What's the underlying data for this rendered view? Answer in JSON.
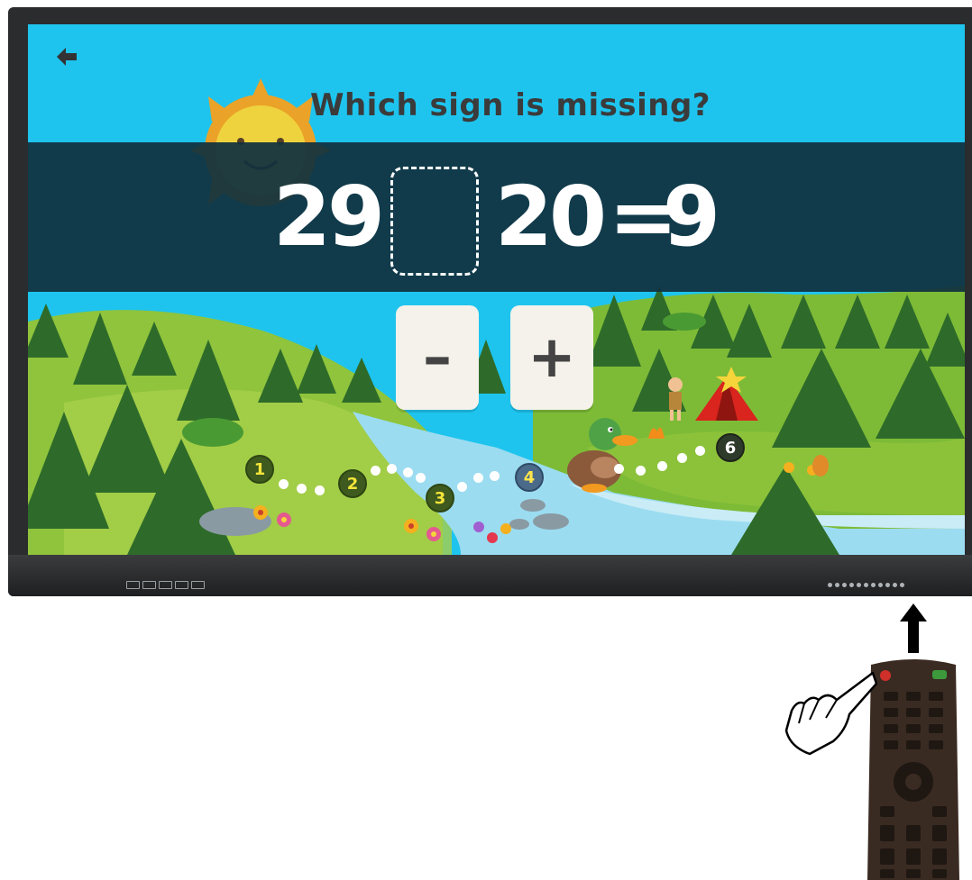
{
  "game": {
    "question": "Which sign is missing?",
    "equation": {
      "left": "29",
      "middle": "20",
      "equals": "=",
      "result": "9"
    },
    "answer_slot": "",
    "choices": [
      "–",
      "+"
    ],
    "path_steps": [
      "1",
      "2",
      "3",
      "4",
      "6"
    ],
    "current_step": "4"
  },
  "icons": {
    "back": "back-arrow-icon",
    "sun": "sun-icon",
    "duck": "duck-character",
    "tent": "tent-icon",
    "camper": "camper-character",
    "campfire": "campfire-icon",
    "remote": "remote-control",
    "hand": "pointing-hand-icon",
    "up_arrow": "up-arrow-icon"
  },
  "colors": {
    "sky": "#1ec4ee",
    "band": "#10303e",
    "grass": "#8fc43c",
    "tree": "#2e6b2a",
    "river": "#9bdcf0",
    "card": "#f4f2ea",
    "step": "#3f5a1e",
    "step_text": "#f5e53a"
  }
}
